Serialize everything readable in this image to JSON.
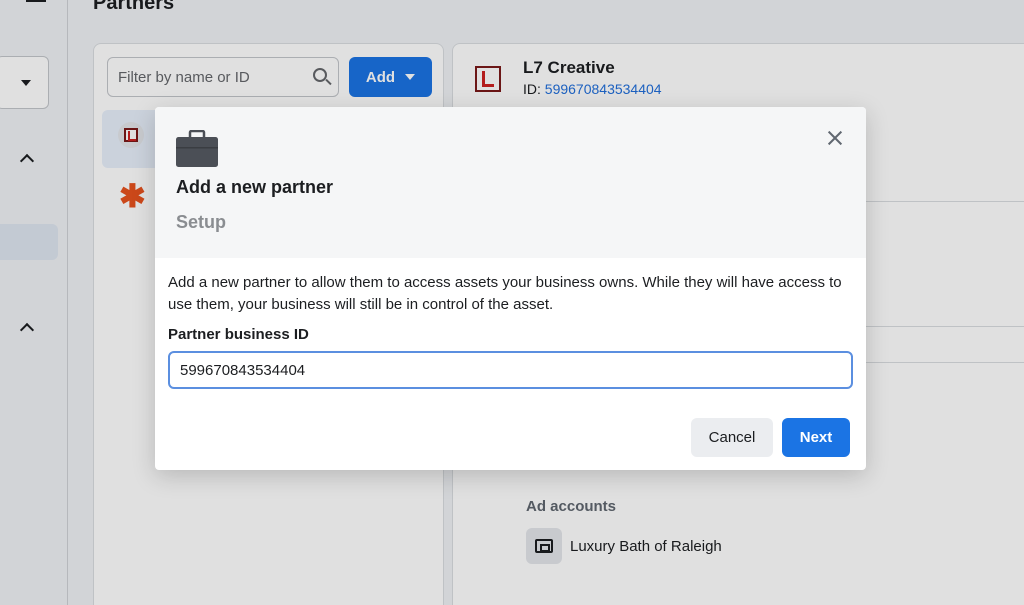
{
  "page": {
    "title": "Partners"
  },
  "list_panel": {
    "filter": {
      "placeholder": "Filter by name or ID",
      "icon": "search-icon"
    },
    "add_button": {
      "label": "Add"
    }
  },
  "detail": {
    "name": "L7 Creative",
    "id_label": "ID:",
    "id_value": "599670843534404",
    "ad_accounts_heading": "Ad accounts",
    "ad_account_name": "Luxury Bath of Raleigh"
  },
  "modal": {
    "title": "Add a new partner",
    "step": "Setup",
    "description": "Add a new partner to allow them to access assets your business owns. While they will have access to use them, your business will still be in control of the asset.",
    "field_label": "Partner business ID",
    "field_value": "599670843534404",
    "cancel_label": "Cancel",
    "next_label": "Next"
  },
  "colors": {
    "accent": "#1b74e4",
    "link": "#216fdb",
    "brand_red": "#cc2222",
    "asterisk": "#e8521e"
  }
}
